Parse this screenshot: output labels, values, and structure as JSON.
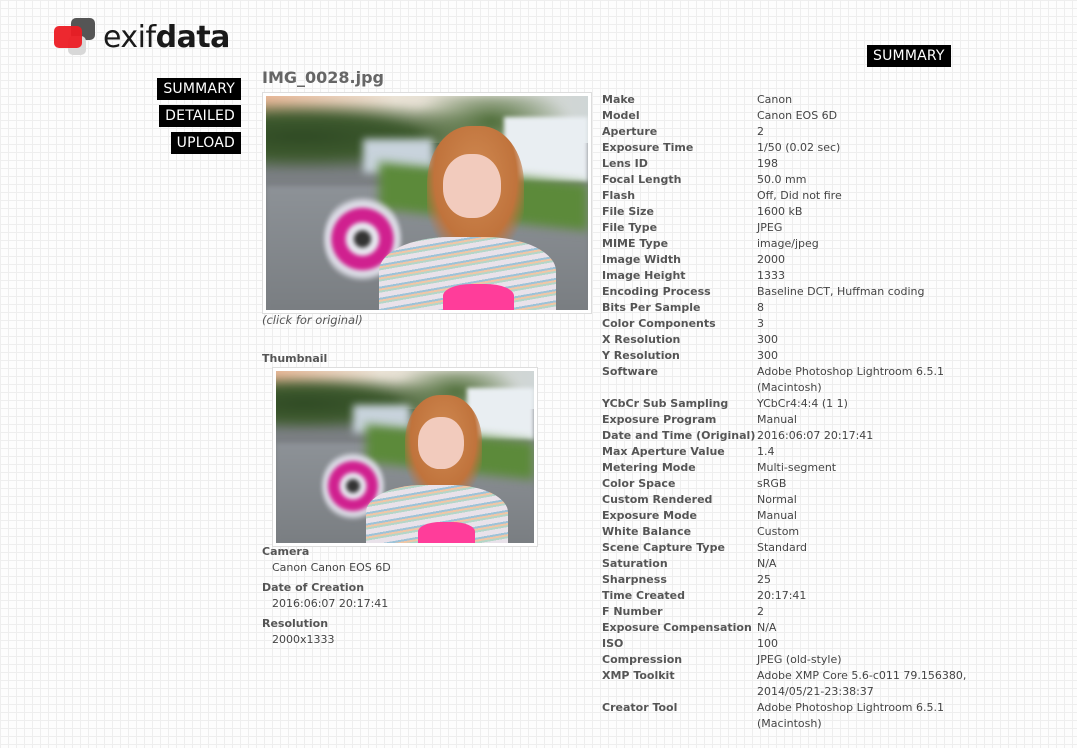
{
  "brand": {
    "light": "exif",
    "bold": "data",
    "colors": {
      "red": "#ec1c24",
      "dark": "#555555",
      "light": "#d8d8d8"
    }
  },
  "nav": {
    "top_summary": "SUMMARY",
    "items": [
      {
        "label": "SUMMARY"
      },
      {
        "label": "DETAILED"
      },
      {
        "label": "UPLOAD"
      }
    ]
  },
  "file": {
    "name": "IMG_0028.jpg",
    "caption": "(click for original)",
    "thumbnail_label": "Thumbnail"
  },
  "summary": [
    {
      "label": "Camera",
      "value": "Canon Canon EOS 6D"
    },
    {
      "label": "Date of Creation",
      "value": "2016:06:07 20:17:41"
    },
    {
      "label": "Resolution",
      "value": "2000x1333"
    }
  ],
  "exif": [
    {
      "key": "Make",
      "value": "Canon"
    },
    {
      "key": "Model",
      "value": "Canon EOS 6D"
    },
    {
      "key": "Aperture",
      "value": "2"
    },
    {
      "key": "Exposure Time",
      "value": "1/50 (0.02 sec)"
    },
    {
      "key": "Lens ID",
      "value": "198"
    },
    {
      "key": "Focal Length",
      "value": "50.0 mm"
    },
    {
      "key": "Flash",
      "value": "Off, Did not fire"
    },
    {
      "key": "File Size",
      "value": "1600 kB"
    },
    {
      "key": "File Type",
      "value": "JPEG"
    },
    {
      "key": "MIME Type",
      "value": "image/jpeg"
    },
    {
      "key": "Image Width",
      "value": "2000"
    },
    {
      "key": "Image Height",
      "value": "1333"
    },
    {
      "key": "Encoding Process",
      "value": "Baseline DCT, Huffman coding"
    },
    {
      "key": "Bits Per Sample",
      "value": "8"
    },
    {
      "key": "Color Components",
      "value": "3"
    },
    {
      "key": "X Resolution",
      "value": "300"
    },
    {
      "key": "Y Resolution",
      "value": "300"
    },
    {
      "key": "Software",
      "value": "Adobe Photoshop Lightroom 6.5.1 (Macintosh)"
    },
    {
      "key": "YCbCr Sub Sampling",
      "value": "YCbCr4:4:4 (1 1)"
    },
    {
      "key": "Exposure Program",
      "value": "Manual"
    },
    {
      "key": "Date and Time (Original)",
      "value": "2016:06:07 20:17:41"
    },
    {
      "key": "Max Aperture Value",
      "value": "1.4"
    },
    {
      "key": "Metering Mode",
      "value": "Multi-segment"
    },
    {
      "key": "Color Space",
      "value": "sRGB"
    },
    {
      "key": "Custom Rendered",
      "value": "Normal"
    },
    {
      "key": "Exposure Mode",
      "value": "Manual"
    },
    {
      "key": "White Balance",
      "value": "Custom"
    },
    {
      "key": "Scene Capture Type",
      "value": "Standard"
    },
    {
      "key": "Saturation",
      "value": "N/A"
    },
    {
      "key": "Sharpness",
      "value": "25"
    },
    {
      "key": "Time Created",
      "value": "20:17:41"
    },
    {
      "key": "F Number",
      "value": "2"
    },
    {
      "key": "Exposure Compensation",
      "value": "N/A"
    },
    {
      "key": "ISO",
      "value": "100"
    },
    {
      "key": "Compression",
      "value": "JPEG (old-style)"
    },
    {
      "key": "XMP Toolkit",
      "value": "Adobe XMP Core 5.6-c011 79.156380, 2014/05/21-23:38:37"
    },
    {
      "key": "Creator Tool",
      "value": "Adobe Photoshop Lightroom 6.5.1 (Macintosh)"
    }
  ]
}
